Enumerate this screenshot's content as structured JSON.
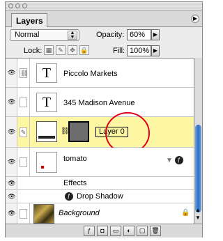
{
  "panel": {
    "title_tab": "Layers",
    "blend_mode": "Normal",
    "opacity_label": "Opacity:",
    "opacity_value": "60%",
    "lock_label": "Lock:",
    "fill_label": "Fill:",
    "fill_value": "100%"
  },
  "layers": [
    {
      "name": "Piccolo Markets",
      "thumb": "T",
      "type": "text"
    },
    {
      "name": "345 Madison Avenue",
      "thumb": "T",
      "type": "text"
    },
    {
      "name": "Layer 0",
      "type": "image",
      "selected": true
    },
    {
      "name": "tomato",
      "type": "shape"
    },
    {
      "name": "Effects"
    },
    {
      "name": "Drop Shadow"
    },
    {
      "name": "Background",
      "type": "background",
      "locked": true
    }
  ],
  "colors": {
    "selected_row": "#fdf7a3",
    "annotation_circle": "#e0001b",
    "scroll_thumb": "#2a6fc4"
  }
}
